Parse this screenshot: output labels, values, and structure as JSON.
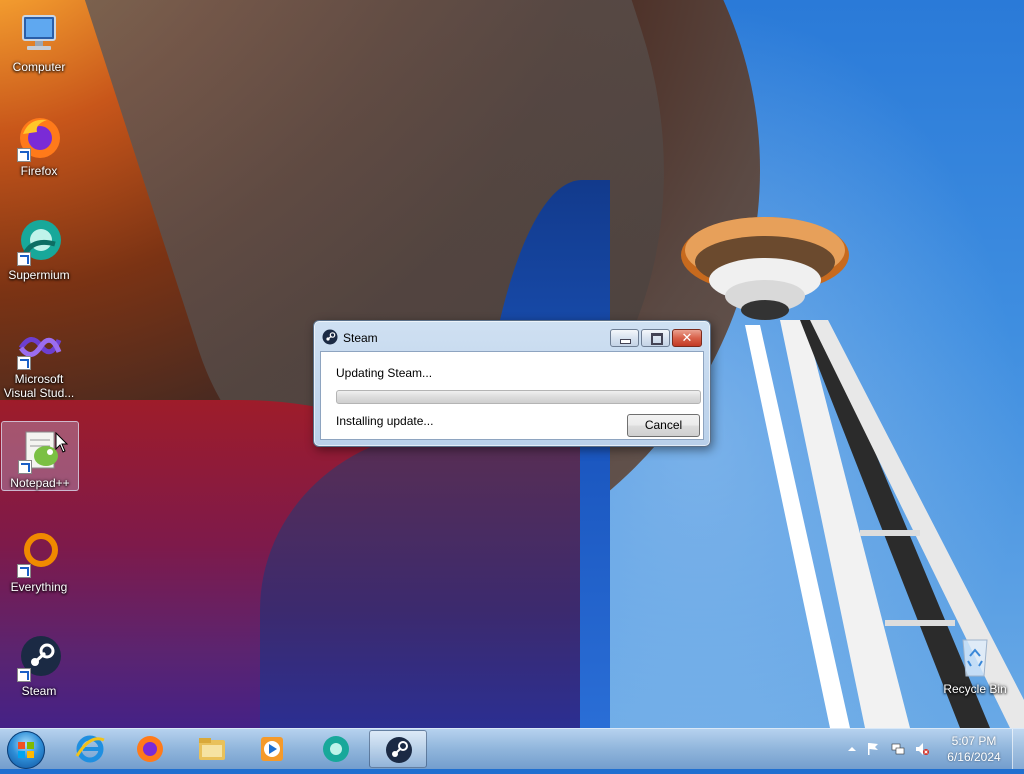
{
  "desktop": {
    "icons": [
      {
        "label": "Computer",
        "icon": "computer-icon"
      },
      {
        "label": "Firefox",
        "icon": "firefox-icon"
      },
      {
        "label": "Supermium",
        "icon": "supermium-icon"
      },
      {
        "label": "Microsoft Visual Stud...",
        "icon": "visual-studio-icon"
      },
      {
        "label": "Notepad++",
        "icon": "notepad-plus-plus-icon"
      },
      {
        "label": "Everything",
        "icon": "everything-icon"
      },
      {
        "label": "Steam",
        "icon": "steam-icon"
      },
      {
        "label": "Recycle Bin",
        "icon": "recycle-bin-icon"
      }
    ]
  },
  "dialog": {
    "title": "Steam",
    "status_main": "Updating Steam...",
    "progress_fraction": 0,
    "status_sub": "Installing update...",
    "cancel_label": "Cancel"
  },
  "taskbar": {
    "pinned": [
      "internet-explorer-icon",
      "firefox-icon",
      "file-explorer-icon",
      "media-player-icon",
      "supermium-icon",
      "steam-icon"
    ],
    "active_app": "steam-icon",
    "clock_time": "5:07 PM",
    "clock_date": "6/16/2024"
  },
  "colors": {
    "accent": "#1a5fc6",
    "close_button": "#c23a25",
    "progress_fill": "#5fc23a"
  }
}
